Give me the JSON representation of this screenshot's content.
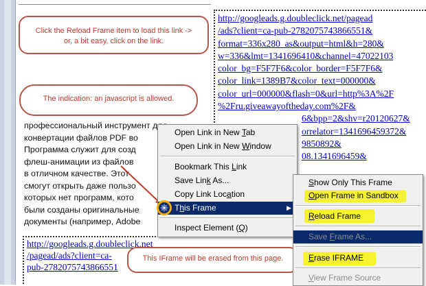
{
  "callouts": {
    "reload_hint": [
      "Click the Reload Frame item to load this link ->",
      "or, a bit easy, click on the link."
    ],
    "indication": "The indication: an javascript is allowed.",
    "erase_hint": "This IFrame will be erased from this page."
  },
  "ad_frame_lines": [
    "http://googleads.g.doubleclick.net/pagead",
    "/ads?client=ca-pub-2782075743866551&",
    "format=336x280_as&output=html&h=280&",
    "w=336&lmt=1341696410&channel=47022103",
    "color_bg=F5F7F6&color_border=F5F7F6&",
    "color_link=1389B7&color_text=000000&",
    "color_url=000000&flash=0&url=http%3A%2F",
    "%2Fru.giveawayoftheday.com%2F&",
    "6&bpp=2&shv=r20120627&",
    "orrelator=1341696459372&",
    "9850892&",
    "08.1341696459&"
  ],
  "ad_frame2_lines": [
    "http://googleads.g.doubleclick.net",
    "/pagead/ads?client=ca-",
    "pub-2782075743866551"
  ],
  "russian_text_lines": [
    "профессиональный инструмент для",
    "конвертации файлов PDF во",
    "Программа служит для созд",
    "флеш-анимации из файлов",
    "в отличном качестве. Этот",
    "смогут открыть даже пользо",
    "которых нет программ, кото",
    "были созданы оригинальные",
    "документы (например, Adobe"
  ],
  "context_menu": {
    "open_new_tab": {
      "before": "Open Link in New ",
      "u": "T",
      "after": "ab"
    },
    "open_new_window": {
      "before": "Open Link in New ",
      "u": "W",
      "after": "indow"
    },
    "bookmark_link": {
      "before": "Bookmark This ",
      "u": "L",
      "after": "ink"
    },
    "save_link_as": {
      "before": "Save Lin",
      "u": "k",
      "after": " As..."
    },
    "copy_link_location": {
      "before": "Copy Link Loc",
      "u": "a",
      "after": "tion"
    },
    "this_frame": {
      "before": "T",
      "u": "h",
      "after": "is Frame"
    },
    "inspect_element": {
      "before": "Inspect Element (",
      "u": "Q",
      "after": ")"
    }
  },
  "submenu": {
    "show_only_frame": {
      "before": "",
      "u": "S",
      "after": "how Only This Frame"
    },
    "open_in_sandbox": {
      "before": "",
      "u": "O",
      "after": "pen Frame in Sandbox"
    },
    "reload_frame": {
      "before": "",
      "u": "R",
      "after": "eload Frame"
    },
    "save_frame_as": {
      "before": "Save ",
      "u": "F",
      "after": "rame As..."
    },
    "erase_iframe": {
      "before": "",
      "u": "E",
      "after": "rase IFRAME"
    },
    "view_frame_source": {
      "before": "",
      "u": "V",
      "after": "iew Frame Source"
    }
  },
  "icons": {
    "this_frame_icon": "gear-icon",
    "submenu_arrow": "chevron-right-icon"
  },
  "colors": {
    "callout_border": "#b8554a",
    "callout_text": "#c0392b",
    "highlight": "#0b2a6b",
    "marker_yellow": "#f6f231",
    "ring": "#f2a800"
  }
}
